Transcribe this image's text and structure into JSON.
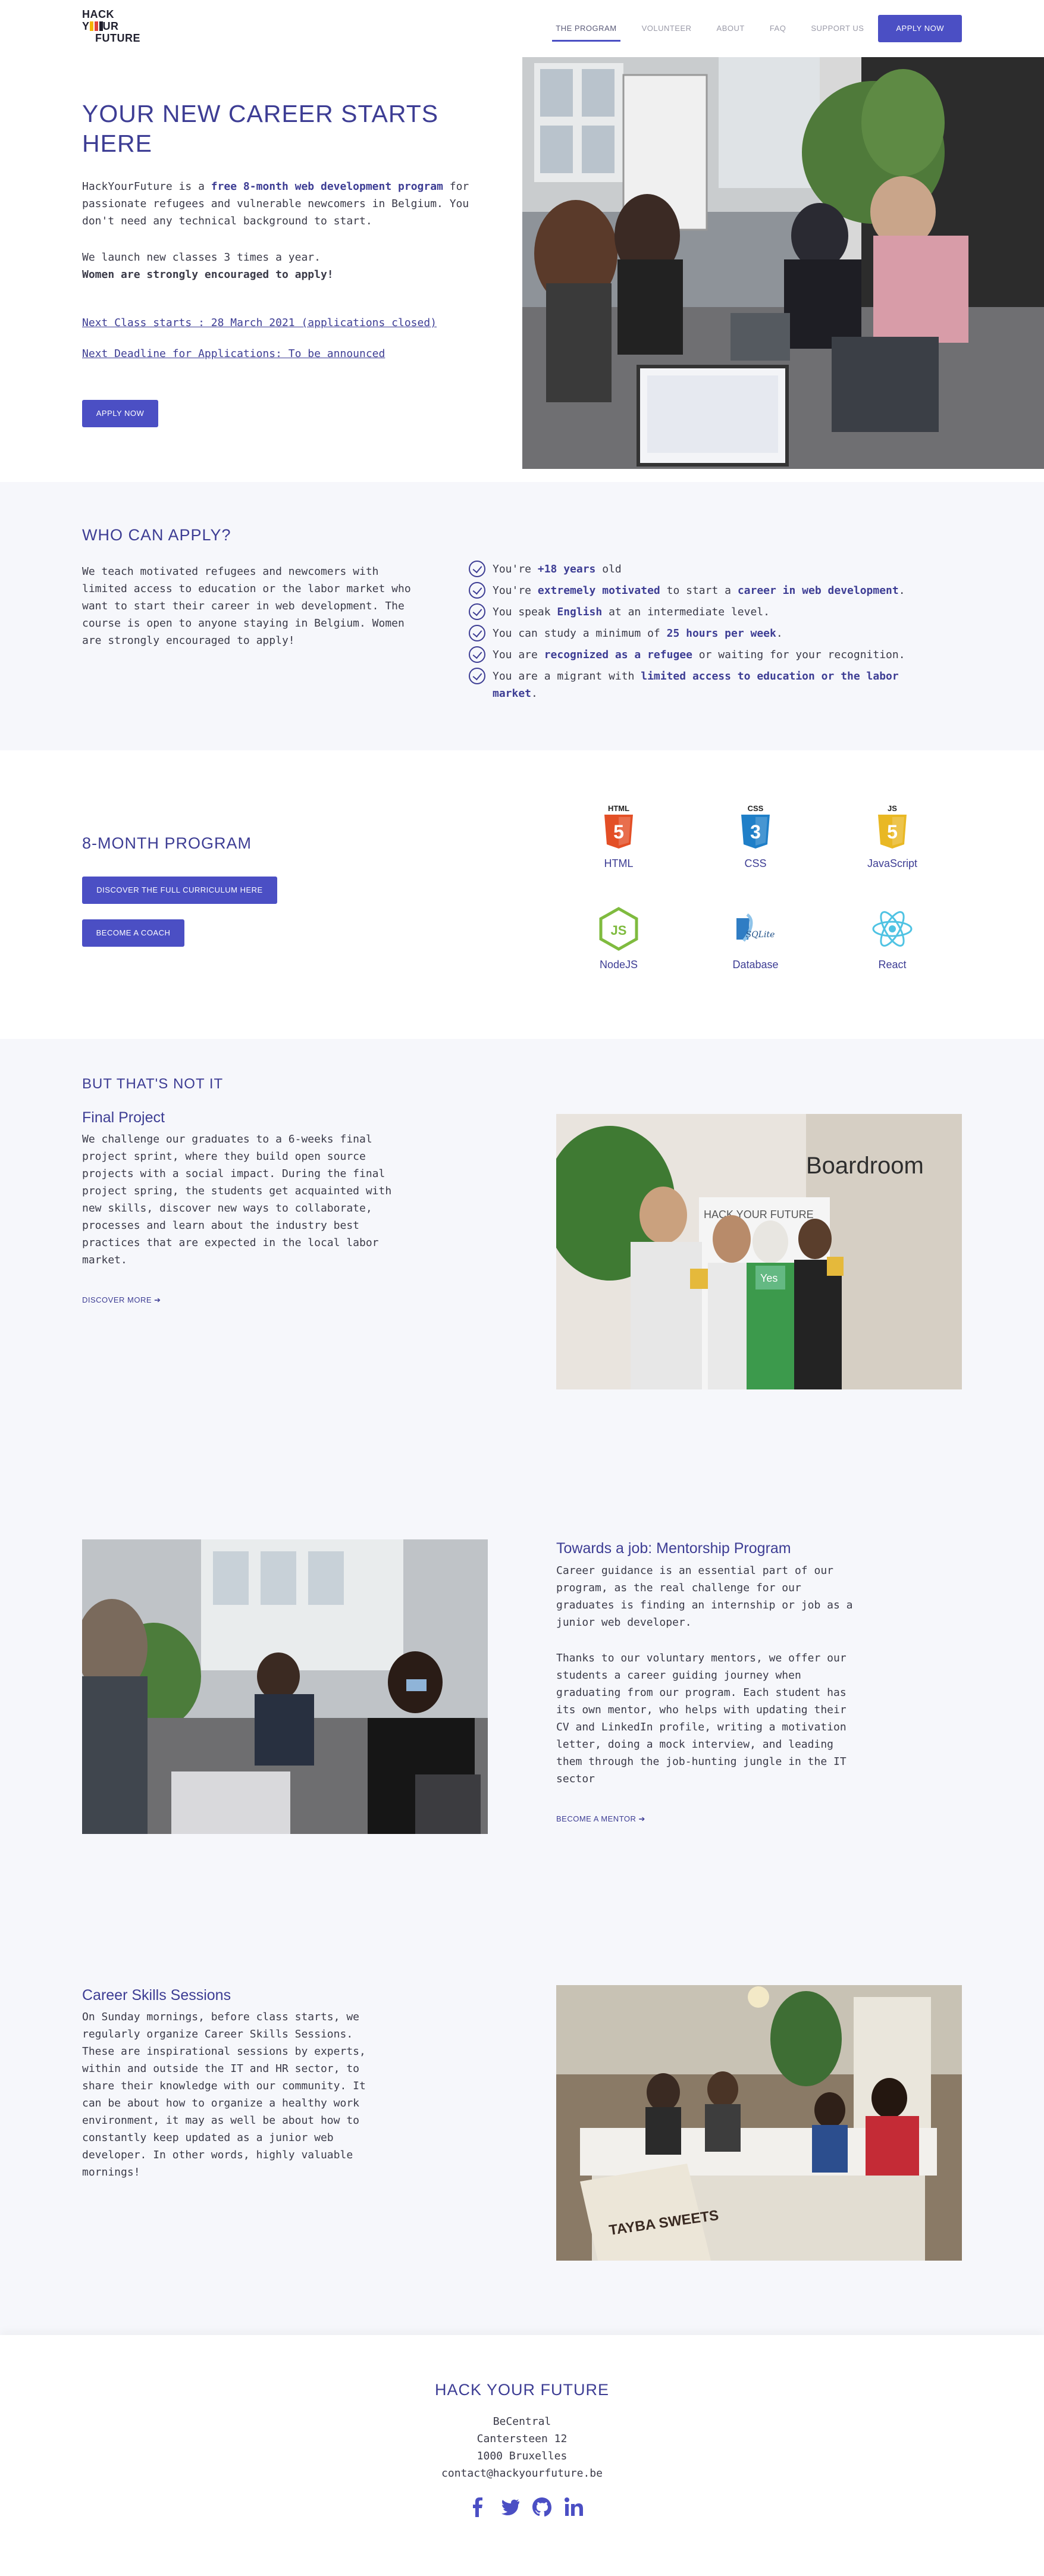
{
  "header": {
    "logo": {
      "line1": "HACK",
      "line2_pre": "Y",
      "line2_post": "UR",
      "line3": "FUTURE"
    },
    "nav": [
      "THE PROGRAM",
      "VOLUNTEER",
      "ABOUT",
      "FAQ",
      "SUPPORT US"
    ],
    "active_nav": "THE PROGRAM",
    "apply_label": "APPLY NOW"
  },
  "hero": {
    "title": "YOUR NEW CAREER STARTS HERE",
    "intro_1": "HackYourFuture is a ",
    "intro_bold": "free 8-month web development program",
    "intro_2": " for passionate refugees and vulnerable newcomers in Belgium. You don't need any technical background to start.",
    "classes": "We launch new classes 3 times a year.",
    "women": "Women are strongly encouraged to apply!",
    "next_class": "Next Class starts : 28 March 2021 (applications closed)",
    "next_deadline": "Next Deadline for Applications: To be announced",
    "apply_label": "APPLY NOW"
  },
  "who": {
    "title": "WHO CAN APPLY?",
    "text": "We teach motivated refugees and newcomers with limited access to education or the labor market who want to start their career in web development. The course is open to anyone staying in Belgium. Women are strongly encouraged to apply!",
    "criteria": [
      {
        "pre": "You're ",
        "bold": "+18 years",
        "post": " old",
        "bold2": "",
        "post2": ""
      },
      {
        "pre": "You're ",
        "bold": "extremely motivated",
        "post": " to start a ",
        "bold2": "career in web development",
        "post2": "."
      },
      {
        "pre": "You speak ",
        "bold": "English",
        "post": " at an intermediate level.",
        "bold2": "",
        "post2": ""
      },
      {
        "pre": "You can study a minimum of ",
        "bold": "25 hours per week",
        "post": ".",
        "bold2": "",
        "post2": ""
      },
      {
        "pre": "You are ",
        "bold": "recognized as a refugee",
        "post": " or waiting for your recognition.",
        "bold2": "",
        "post2": ""
      },
      {
        "pre": "You are a migrant with ",
        "bold": "limited access to education or the labor market",
        "post": ".",
        "bold2": "",
        "post2": ""
      }
    ]
  },
  "program": {
    "title": "8-MONTH PROGRAM",
    "curriculum_label": "DISCOVER THE FULL CURRICULUM HERE",
    "coach_label": "BECOME A COACH",
    "techs": [
      {
        "name": "HTML",
        "icon": "html5-icon",
        "badge": "HTML",
        "num": "5",
        "color": "#e34f26"
      },
      {
        "name": "CSS",
        "icon": "css3-icon",
        "badge": "CSS",
        "num": "3",
        "color": "#1f7fc8"
      },
      {
        "name": "JavaScript",
        "icon": "javascript-icon",
        "badge": "JS",
        "num": "5",
        "color": "#e9b824"
      },
      {
        "name": "NodeJS",
        "icon": "nodejs-icon",
        "badge": "JS",
        "num": "",
        "color": "#7fbb3f"
      },
      {
        "name": "Database",
        "icon": "database-icon",
        "badge": "SQLite",
        "num": "",
        "color": "#2f7dc4"
      },
      {
        "name": "React",
        "icon": "react-icon",
        "badge": "",
        "num": "",
        "color": "#4fc3e3"
      }
    ]
  },
  "more": {
    "title": "BUT THAT'S NOT IT",
    "final": {
      "title": "Final Project",
      "text": "We challenge our graduates to a 6-weeks final project sprint, where they build open source projects with a social impact. During the final project spring, the students get acquainted with new skills, discover new ways to collaborate, processes and learn about the industry best practices that are expected in the local labor market.",
      "link": "DISCOVER MORE",
      "photo_sign": "Boardroom",
      "photo_banner": "HACK YOUR FUTURE",
      "photo_card": "Yes"
    },
    "mentor": {
      "title": "Towards a job: Mentorship Program",
      "text1": "Career guidance is an essential part of our program, as the real challenge for our graduates is finding an internship or job as a junior web developer.",
      "text2": "Thanks to our voluntary mentors, we offer our students a career guiding journey when graduating from our program. Each student has its own mentor, who helps with updating their CV and LinkedIn profile, writing a motivation letter, doing a mock interview, and leading them through the job-hunting jungle in the IT sector",
      "link": "BECOME A MENTOR"
    },
    "skills": {
      "title": "Career Skills Sessions",
      "text": "On Sunday mornings, before class starts, we regularly organize Career Skills Sessions. These are inspirational sessions by experts, within and outside the IT and HR sector, to share their knowledge with our community. It can be about how to organize a healthy work environment, it may as well be about how to constantly keep updated as a junior web developer. In other words, highly valuable mornings!",
      "photo_bag": "TAYBA SWEETS"
    }
  },
  "footer": {
    "title": "HACK YOUR FUTURE",
    "address": [
      "BeCentral",
      "Cantersteen 12",
      "1000 Bruxelles",
      "contact@hackyourfuture.be"
    ],
    "social": [
      "facebook-icon",
      "twitter-icon",
      "github-icon",
      "linkedin-icon"
    ]
  },
  "colors": {
    "accent": "#3d3d94",
    "button": "#4b4fc4",
    "section_bg": "#f6f7fb"
  }
}
